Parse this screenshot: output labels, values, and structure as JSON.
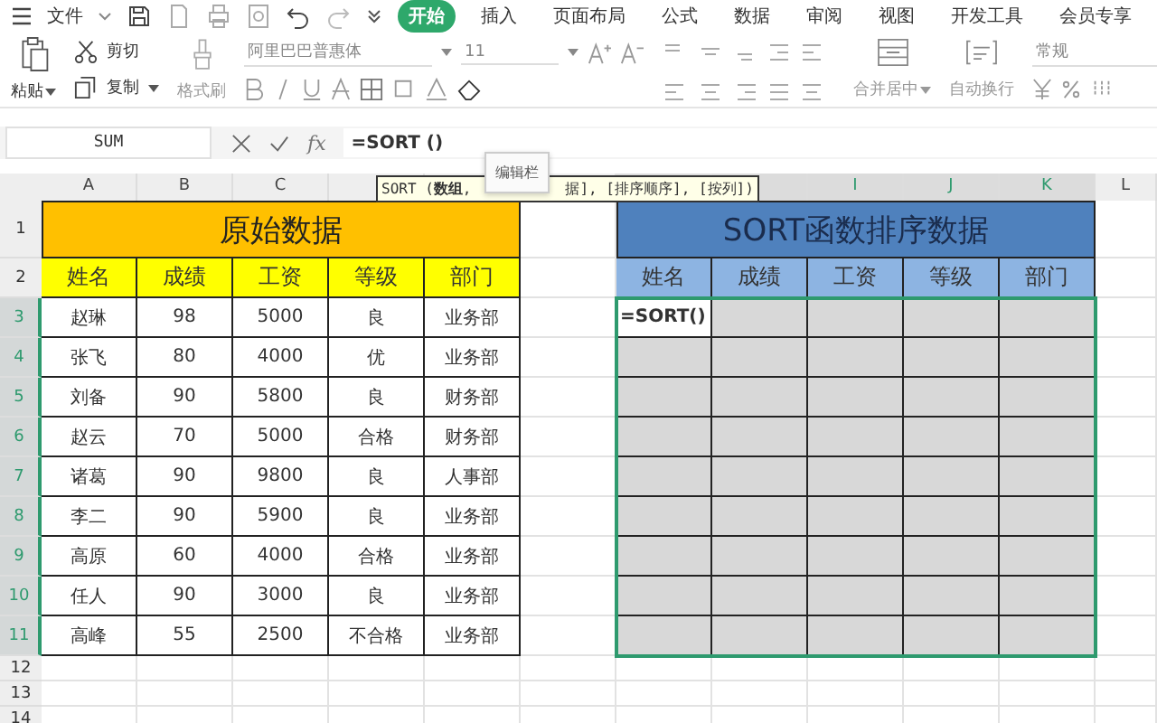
{
  "menu": {
    "file": "文件",
    "tabs": [
      {
        "label": "开始",
        "selected": true
      },
      {
        "label": "插入",
        "selected": false
      },
      {
        "label": "页面布局",
        "selected": false
      },
      {
        "label": "公式",
        "selected": false
      },
      {
        "label": "数据",
        "selected": false
      },
      {
        "label": "审阅",
        "selected": false
      },
      {
        "label": "视图",
        "selected": false
      },
      {
        "label": "开发工具",
        "selected": false
      },
      {
        "label": "会员专享",
        "selected": false
      }
    ]
  },
  "ribbon": {
    "paste": "粘贴",
    "cut": "剪切",
    "copy": "复制",
    "format_painter": "格式刷",
    "font": "阿里巴巴普惠体",
    "font_size": "11",
    "merge": "合并居中",
    "wrap": "自动换行",
    "number_format": "常规"
  },
  "formula_bar": {
    "name_box": "SUM",
    "function_button": "fx",
    "formula": "=SORT ()"
  },
  "tooltips": {
    "syntax_start": "SORT (**数组**,",
    "syntax_end": "据], [排序顺序], [按列])",
    "label": "编辑栏"
  },
  "columns": [
    {
      "label": "A",
      "selected": false
    },
    {
      "label": "B",
      "selected": false
    },
    {
      "label": "C",
      "selected": false
    },
    {
      "selected": false
    },
    {
      "selected": false
    },
    {
      "selected": false
    },
    {
      "selected": true
    },
    {
      "selected": true
    },
    {
      "label": "I",
      "selected": true
    },
    {
      "label": "J",
      "selected": true
    },
    {
      "label": "K",
      "selected": true
    },
    {
      "label": "L",
      "selected": false
    }
  ],
  "rows": [
    {
      "label": "1",
      "selected": false
    },
    {
      "label": "2",
      "selected": false
    },
    {
      "label": "3",
      "selected": true
    },
    {
      "label": "4",
      "selected": true
    },
    {
      "label": "5",
      "selected": true
    },
    {
      "label": "6",
      "selected": true
    },
    {
      "label": "7",
      "selected": true
    },
    {
      "label": "8",
      "selected": true
    },
    {
      "label": "9",
      "selected": true
    },
    {
      "label": "10",
      "selected": true
    },
    {
      "label": "11",
      "selected": true
    },
    {
      "label": "12",
      "selected": false
    },
    {
      "label": "13",
      "selected": false
    },
    {
      "label": "14",
      "selected": false
    }
  ],
  "source_table": {
    "title": "原始数据",
    "headers": [
      "姓名",
      "成绩",
      "工资",
      "等级",
      "部门"
    ],
    "rows": [
      [
        "赵琳",
        "98",
        "5000",
        "良",
        "业务部"
      ],
      [
        "张飞",
        "80",
        "4000",
        "优",
        "业务部"
      ],
      [
        "刘备",
        "90",
        "5800",
        "良",
        "财务部"
      ],
      [
        "赵云",
        "70",
        "5000",
        "合格",
        "财务部"
      ],
      [
        "诸葛",
        "90",
        "9800",
        "良",
        "人事部"
      ],
      [
        "李二",
        "90",
        "5900",
        "良",
        "业务部"
      ],
      [
        "高原",
        "60",
        "4000",
        "合格",
        "业务部"
      ],
      [
        "任人",
        "90",
        "3000",
        "良",
        "业务部"
      ],
      [
        "高峰",
        "55",
        "2500",
        "不合格",
        "业务部"
      ]
    ]
  },
  "result_table": {
    "title": "SORT函数排序数据",
    "headers": [
      "姓名",
      "成绩",
      "工资",
      "等级",
      "部门"
    ],
    "active_cell": "=SORT()"
  }
}
